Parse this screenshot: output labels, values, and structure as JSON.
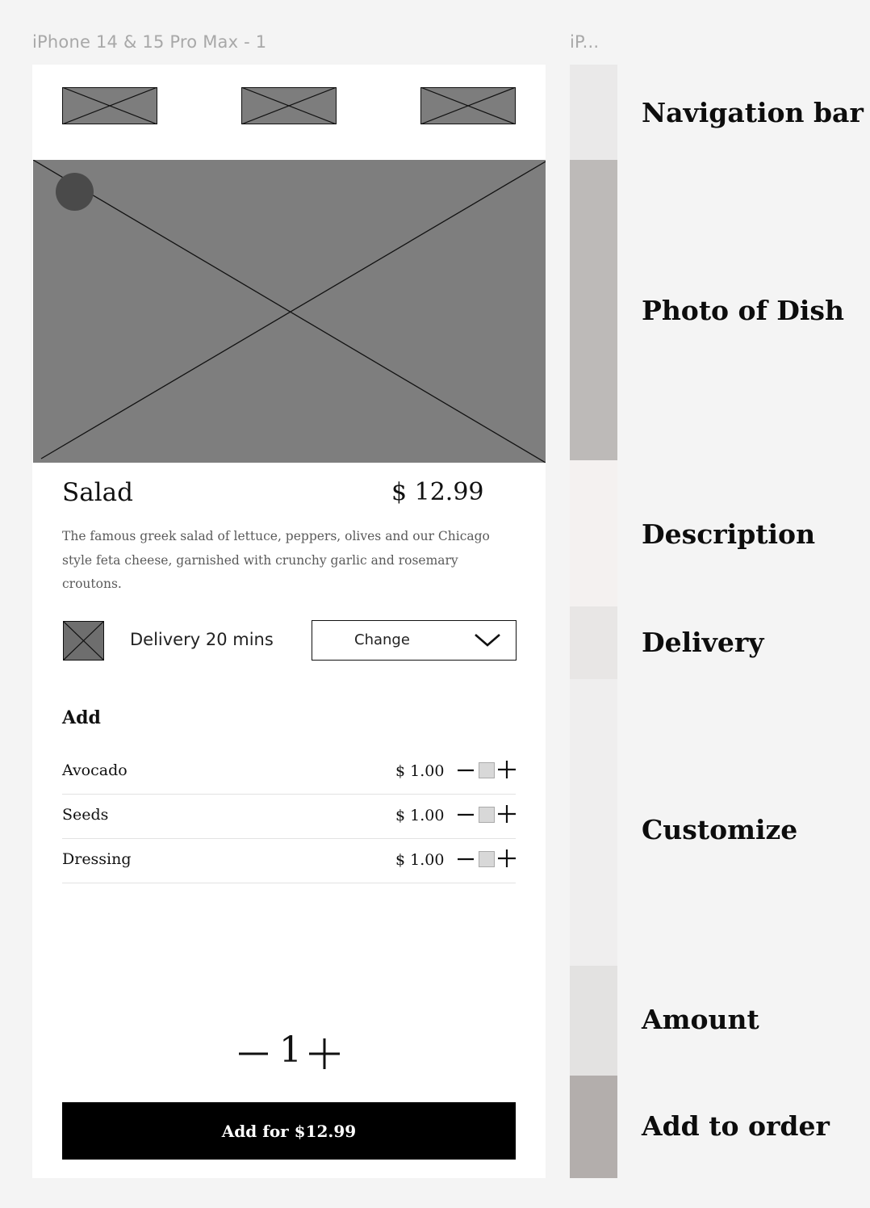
{
  "canvas": {
    "frame_label": "iPhone 14 & 15 Pro Max - 1",
    "second_frame_label": "iP..."
  },
  "dish": {
    "name": "Salad",
    "price": "$ 12.99",
    "description": "The famous greek salad of lettuce, peppers, olives and our Chicago style feta cheese, garnished with crunchy garlic and rosemary croutons."
  },
  "delivery": {
    "text": "Delivery 20 mins",
    "change_label": "Change"
  },
  "addons": {
    "heading": "Add",
    "items": [
      {
        "name": "Avocado",
        "price": "$ 1.00"
      },
      {
        "name": "Seeds",
        "price": "$ 1.00"
      },
      {
        "name": "Dressing",
        "price": "$ 1.00"
      }
    ]
  },
  "quantity": {
    "value": "1"
  },
  "order_button": {
    "label": "Add for $12.99"
  },
  "annotations": [
    {
      "label": "Navigation bar",
      "color": "#eae9e9"
    },
    {
      "label": "Photo of Dish",
      "color": "#bdbab8"
    },
    {
      "label": "Description",
      "color": "#f4f1f0"
    },
    {
      "label": "Delivery",
      "color": "#e8e6e5"
    },
    {
      "label": "Customize",
      "color": "#efeeee"
    },
    {
      "label": "Amount",
      "color": "#e3e2e1"
    },
    {
      "label": "Add to order",
      "color": "#b3aeac"
    }
  ],
  "icons": [
    "image-placeholder-icon",
    "back-icon",
    "chevron-down-icon",
    "minus-icon",
    "plus-icon"
  ]
}
